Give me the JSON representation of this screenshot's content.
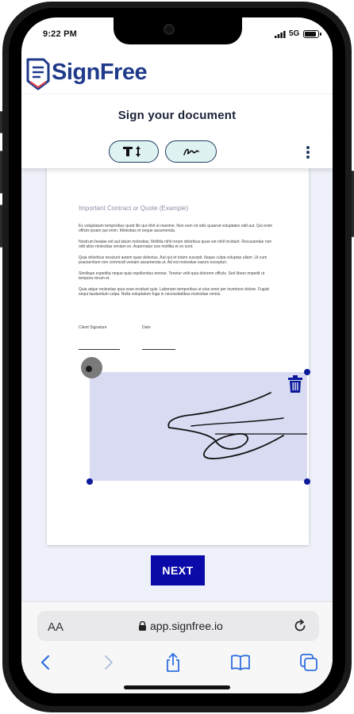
{
  "status_bar": {
    "time": "9:22 PM",
    "network": "5G"
  },
  "app": {
    "brand": "SignFree",
    "page_title": "Sign your document",
    "toolbar": {
      "text_tool_icon": "text-size-icon",
      "signature_tool_icon": "signature-icon",
      "menu_icon": "kebab-menu-icon"
    }
  },
  "document": {
    "title": "Important Contract or Quote (Example)",
    "paragraphs": [
      "Ex voluptatum temporibus quod illo qui nihil ut maxime. Non eum sit odio quaerat voluptates odit aut. Qui enim officiis ipsam qui enim. Molestias et neque assumenda.",
      "Nostrum beatae est aut tatum molestias. Mollitia nihil rerum doloribus quae est nihil incidunt. Recusandae non odit alios molestias veniam ex. Aspernatur iure mollitia et ex sunt.",
      "Quia doloribus nesciunt autem quas delectus. Aut qui et totam suscipit. Itaque culpa voluptas ullam. Ut cum praesentium non commodi veniam assumenda ut. Ad est molestiae earum excepturi.",
      "Similique expedita neque quia repellendus tenetur. Tenetur velit quia dolorem officiis. Sed libero impedit ut tempora rerum et.",
      "Quia atque molestiae quia esse incidunt quis. Laboriam temporibus ut eius omni per inventore dolore. Fugiat sequi laudantium culpa. Nulla voluptatum fuga in necessitatibus molestiae omnis."
    ],
    "client_signature_label": "Client Signature",
    "date_label": "Date"
  },
  "signature": {
    "delete_icon": "trash-icon",
    "rotate_handle_icon": "rotate-handle-icon"
  },
  "actions": {
    "next_label": "NEXT"
  },
  "browser": {
    "text_size": "AA",
    "url": "app.signfree.io"
  },
  "colors": {
    "brand": "#1f3a8a",
    "primary_button": "#0a0aa8",
    "signature_box": "#d9dbf3",
    "pill": "#dff2f2"
  }
}
